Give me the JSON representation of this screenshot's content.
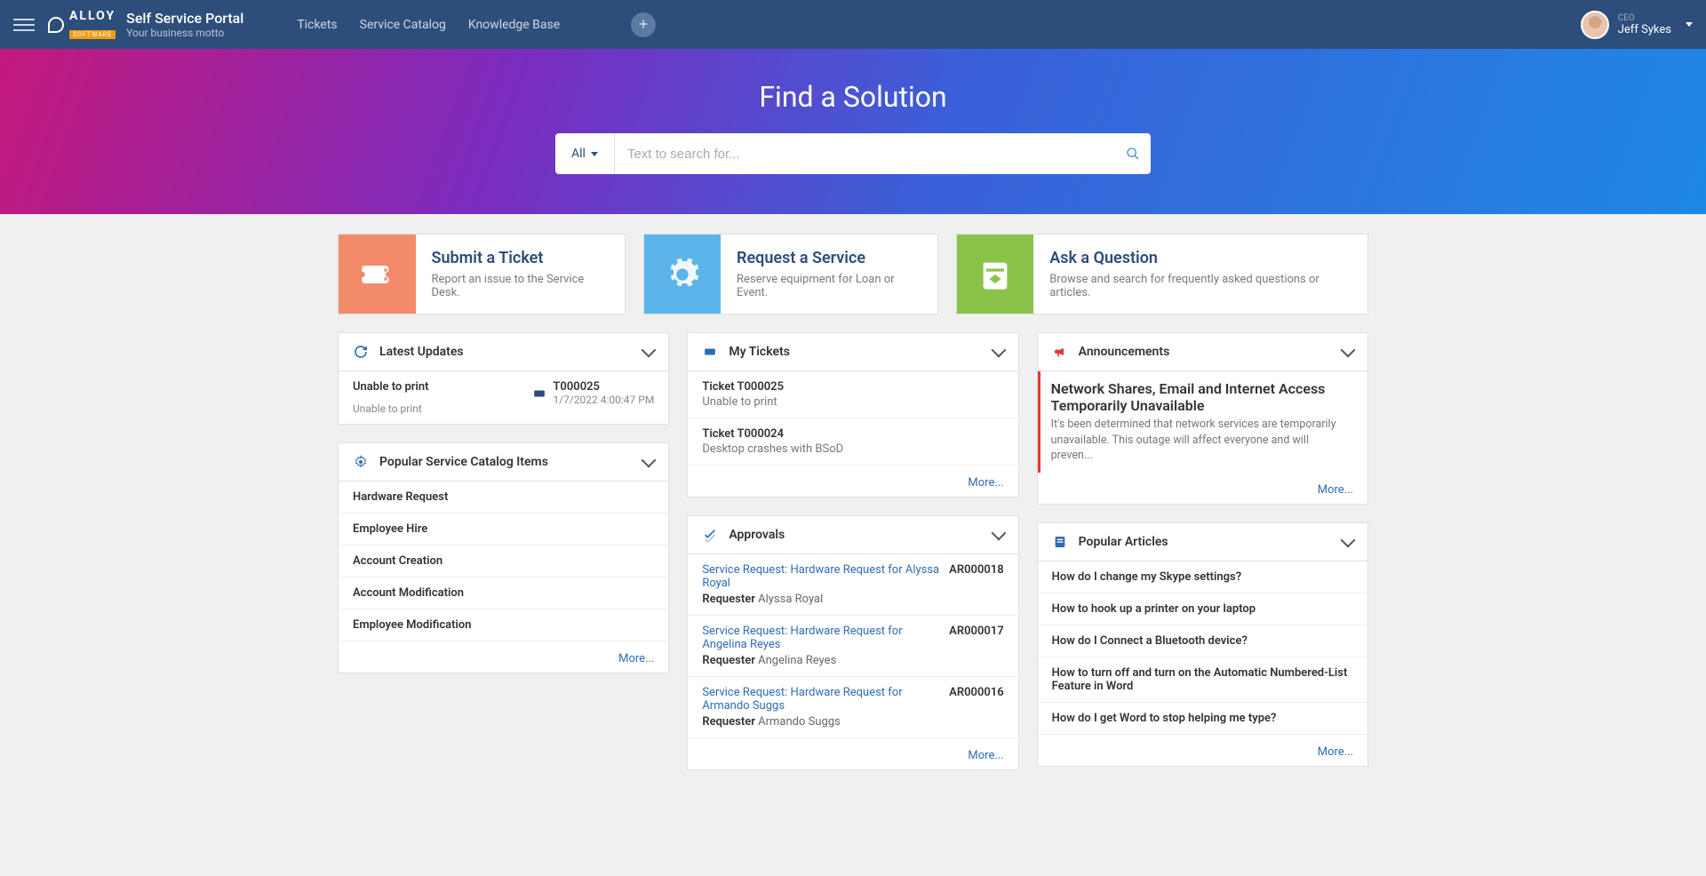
{
  "header": {
    "logo_text": "ALLOY",
    "logo_sub": "SOFTWARE",
    "title": "Self Service Portal",
    "motto": "Your business motto",
    "nav": [
      "Tickets",
      "Service Catalog",
      "Knowledge Base"
    ],
    "user_role": "CEO",
    "user_name": "Jeff Sykes"
  },
  "hero": {
    "title": "Find a Solution",
    "filter_label": "All",
    "search_placeholder": "Text to search for..."
  },
  "actions": [
    {
      "title": "Submit a Ticket",
      "desc": "Report an issue to the Service Desk."
    },
    {
      "title": "Request a Service",
      "desc": "Reserve equipment for Loan or Event."
    },
    {
      "title": "Ask a Question",
      "desc": "Browse and search for frequently asked questions or articles."
    }
  ],
  "widgets": {
    "latest_updates": {
      "title": "Latest Updates",
      "item": {
        "title": "Unable to print",
        "desc": "Unable to print",
        "id": "T000025",
        "date": "1/7/2022 4:00:47 PM"
      }
    },
    "popular_catalog": {
      "title": "Popular Service Catalog Items",
      "items": [
        "Hardware Request",
        "Employee Hire",
        "Account Creation",
        "Account Modification",
        "Employee Modification"
      ],
      "more": "More..."
    },
    "my_tickets": {
      "title": "My Tickets",
      "items": [
        {
          "title": "Ticket T000025",
          "desc": "Unable to print"
        },
        {
          "title": "Ticket T000024",
          "desc": "Desktop crashes with BSoD"
        }
      ],
      "more": "More..."
    },
    "approvals": {
      "title": "Approvals",
      "requester_label": "Requester",
      "items": [
        {
          "link": "Service Request: Hardware Request for Alyssa Royal",
          "id": "AR000018",
          "requester": "Alyssa Royal"
        },
        {
          "link": "Service Request: Hardware Request for Angelina Reyes",
          "id": "AR000017",
          "requester": "Angelina Reyes"
        },
        {
          "link": "Service Request: Hardware Request for Armando Suggs",
          "id": "AR000016",
          "requester": "Armando Suggs"
        }
      ],
      "more": "More..."
    },
    "announcements": {
      "title": "Announcements",
      "item": {
        "title": "Network Shares, Email and Internet Access Temporarily Unavailable",
        "body": "It's been determined that network services are temporarily unavailable. This outage will affect everyone and will preven..."
      },
      "more": "More..."
    },
    "popular_articles": {
      "title": "Popular Articles",
      "items": [
        "How do I change my Skype settings?",
        "How to hook up a printer on your laptop",
        "How do I Connect a Bluetooth device?",
        "How to turn off and turn on the Automatic Numbered-List Feature in Word",
        "How do I get Word to stop helping me type?"
      ],
      "more": "More..."
    }
  }
}
